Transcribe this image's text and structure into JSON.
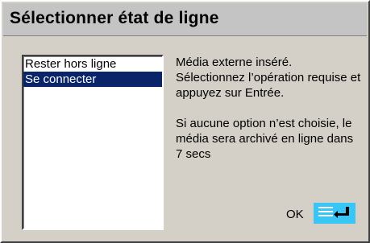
{
  "dialog": {
    "title": "Sélectionner état de ligne"
  },
  "options": [
    {
      "label": "Rester hors ligne",
      "selected": false
    },
    {
      "label": "Se connecter",
      "selected": true
    }
  ],
  "message": {
    "line1": "Média externe inséré. Sélectionnez l’opération requise et appuyez sur Entrée.",
    "line2": "Si aucune option n’est choisie, le média sera archivé en ligne dans 7 secs"
  },
  "ok": {
    "label": "OK",
    "icon": "enter-key-icon"
  },
  "colors": {
    "selection": "#0a246a",
    "enter_icon": "#38c6f6"
  }
}
